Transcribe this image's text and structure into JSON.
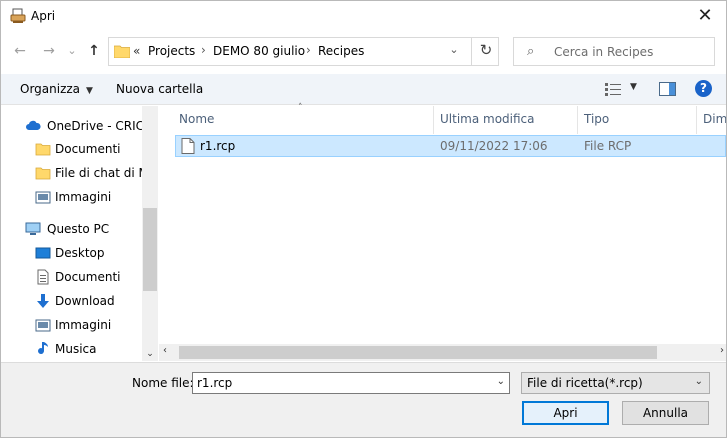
{
  "window": {
    "title": "Apri",
    "close_glyph": "✕"
  },
  "nav": {
    "back_glyph": "←",
    "forward_glyph": "→",
    "chevron_glyph": "⌄",
    "up_glyph": "↑",
    "breadcrumb_prefix": "«",
    "breadcrumbs": [
      "Projects",
      "DEMO 80 giulio",
      "Recipes"
    ],
    "sep_glyph": "›",
    "dropdown_glyph": "⌄",
    "refresh_glyph": "↻"
  },
  "search": {
    "icon_glyph": "⌕",
    "placeholder": "Cerca in Recipes"
  },
  "toolbar": {
    "organize_label": "Organizza",
    "organize_caret": "▼",
    "new_folder_label": "Nuova cartella",
    "view_caret": "▼",
    "help_glyph": "?"
  },
  "sidebar": {
    "items": [
      {
        "label": "OneDrive - CRICK",
        "icon": "cloud-icon"
      },
      {
        "label": "Documenti",
        "icon": "folder-icon"
      },
      {
        "label": "File di chat di Mi",
        "icon": "folder-icon"
      },
      {
        "label": "Immagini",
        "icon": "pictures-icon"
      },
      {
        "label": "Questo PC",
        "icon": "computer-icon"
      },
      {
        "label": "Desktop",
        "icon": "desktop-icon"
      },
      {
        "label": "Documenti",
        "icon": "documents-icon"
      },
      {
        "label": "Download",
        "icon": "download-icon"
      },
      {
        "label": "Immagini",
        "icon": "pictures-icon"
      },
      {
        "label": "Musica",
        "icon": "music-icon"
      }
    ],
    "scroll_down_glyph": "⌄"
  },
  "filelist": {
    "sort_glyph": "˄",
    "columns": [
      "Nome",
      "Ultima modifica",
      "Tipo",
      "Dim"
    ],
    "rows": [
      {
        "name": "r1.rcp",
        "modified": "09/11/2022 17:06",
        "type": "File RCP"
      }
    ],
    "hscroll_left_glyph": "‹",
    "hscroll_right_glyph": "›"
  },
  "footer": {
    "filename_label": "Nome file:",
    "filename_value": "r1.rcp",
    "filename_caret": "⌄",
    "filter_value": "File di ricetta(*.rcp)",
    "filter_caret": "⌄",
    "open_label": "Apri",
    "cancel_label": "Annulla"
  },
  "colors": {
    "selection_fill": "#cce8ff",
    "selection_border": "#99d1ff",
    "accent": "#0078d7",
    "help_blue": "#1a63c9",
    "folder_yellow": "#ffd86b"
  }
}
